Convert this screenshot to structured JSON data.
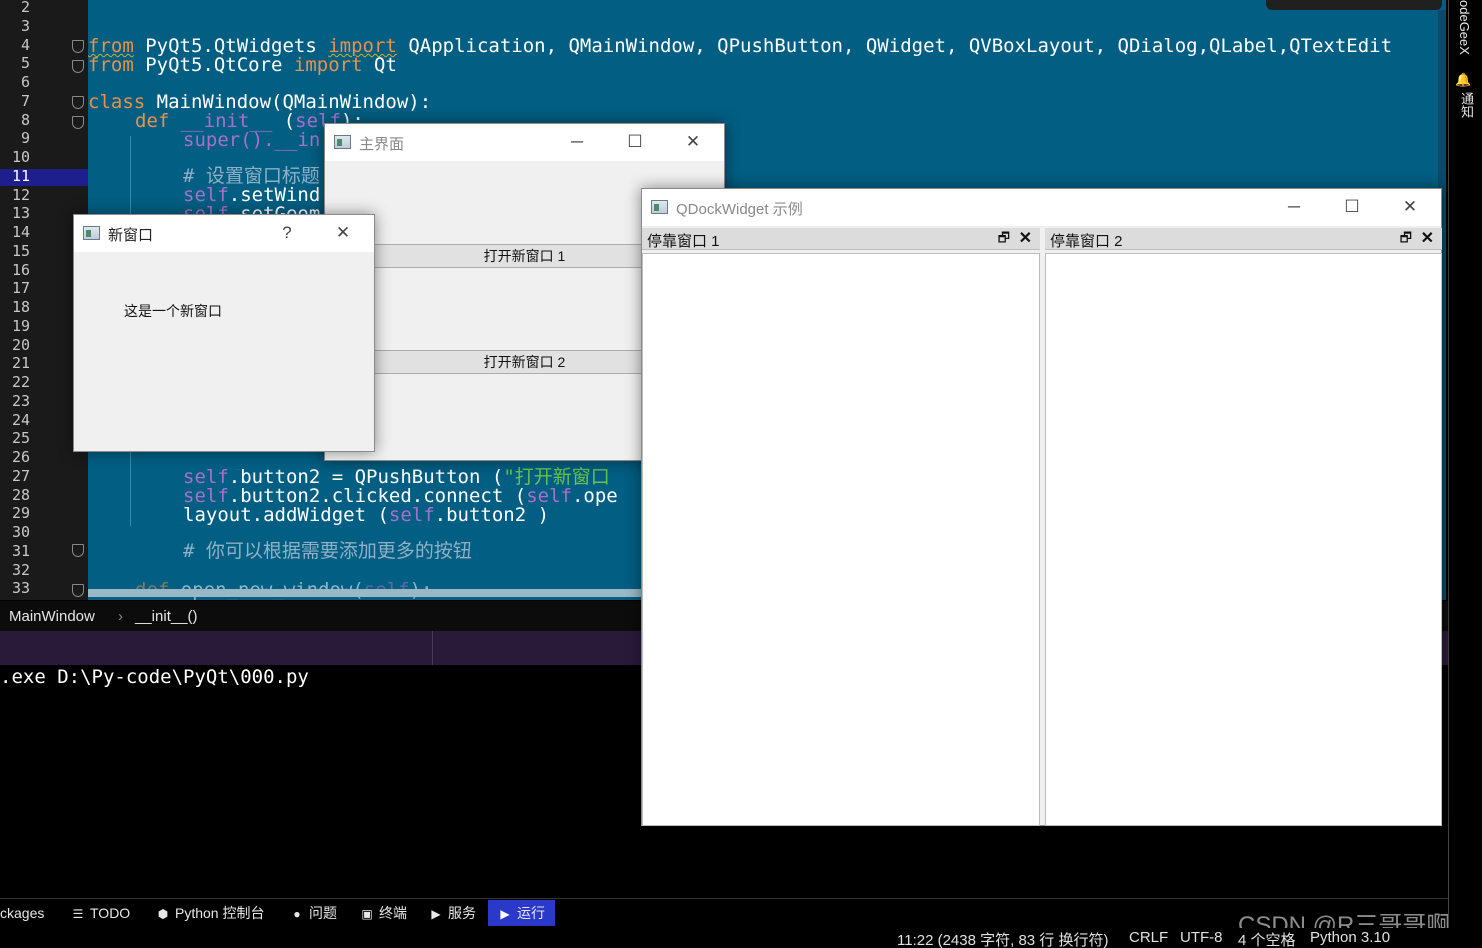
{
  "editor": {
    "line_numbers": [
      "2",
      "3",
      "4",
      "5",
      "6",
      "7",
      "8",
      "9",
      "10",
      "11",
      "12",
      "13",
      "14",
      "15",
      "16",
      "17",
      "18",
      "19",
      "20",
      "21",
      "22",
      "23",
      "24",
      "25",
      "26",
      "27",
      "28",
      "29",
      "30",
      "31",
      "32",
      "33"
    ],
    "active_line": "11",
    "code": {
      "l4_kw1": "from",
      "l4_mod": " PyQt5.QtWidgets ",
      "l4_kw2": "import",
      "l4_rest": " QApplication, QMainWindow, QPushButton, QWidget, QVBoxLayout, QDialog,QLabel,QTextEdit",
      "l5_kw1": "from",
      "l5_mod": " PyQt5.QtCore ",
      "l5_kw2": "import",
      "l5_rest": " Qt",
      "l7_kw": "class",
      "l7_rest": " MainWindow(QMainWindow):",
      "l8_kw": "def",
      "l8_fn": " __init__",
      "l8_rest": " (",
      "l8_self": "self",
      "l8_end": "):",
      "l9": "super().__in",
      "l11": "# 设置窗口标题",
      "l12_self": "self",
      "l12_rest": ".setWind",
      "l13_self": "self",
      "l13_rest": ".setGeom",
      "l27_self": "self",
      "l27_rest": ".button2 = QPushButton (",
      "l27_str": "\"打开新窗口",
      "l28_self": "self",
      "l28_rest": ".button2.clicked.connect (",
      "l28_self2": "self",
      "l28_rest2": ".ope",
      "l29_a": "layout.addWidget (",
      "l29_self": "self",
      "l29_b": ".button2 )",
      "l31": "# 你可以根据需要添加更多的按钮",
      "l33_kw": "def",
      "l33_rest": " open_new_window(",
      "l33_self": "self",
      "l33_end": "):"
    }
  },
  "breadcrumb": {
    "class": "MainWindow",
    "method": "__init__()"
  },
  "console": {
    "line": ".exe D:\\Py-code\\PyQt\\000.py"
  },
  "toolbar": {
    "packages": "ckages",
    "todo": "TODO",
    "python_console": "Python 控制台",
    "problems": "问题",
    "terminal": "终端",
    "services": "服务",
    "run": "运行"
  },
  "statusbar": {
    "position": "11:22 (2438 字符, 83 行 换行符)",
    "line_sep": "CRLF",
    "encoding": "UTF-8",
    "indent": "4 个空格",
    "interpreter": "Python 3.10"
  },
  "watermark": "CSDN @R三哥哥啊",
  "right_bar": {
    "codegeex": "odeGeeX",
    "notifications": "通知"
  },
  "main_window": {
    "title": "主界面",
    "button1": "打开新窗口 1",
    "button2": "打开新窗口 2"
  },
  "dialog": {
    "title": "新窗口",
    "help": "?",
    "label": "这是一个新窗口"
  },
  "dock_window": {
    "title": "QDockWidget 示例",
    "dock1_title": "停靠窗口 1",
    "dock2_title": "停靠窗口 2"
  },
  "colors": {
    "editor_bg": "#025e82",
    "keyword": "#e8914c",
    "self": "#a870cc",
    "string": "#6cc24a",
    "run_tab_active": "#2a39c9"
  }
}
